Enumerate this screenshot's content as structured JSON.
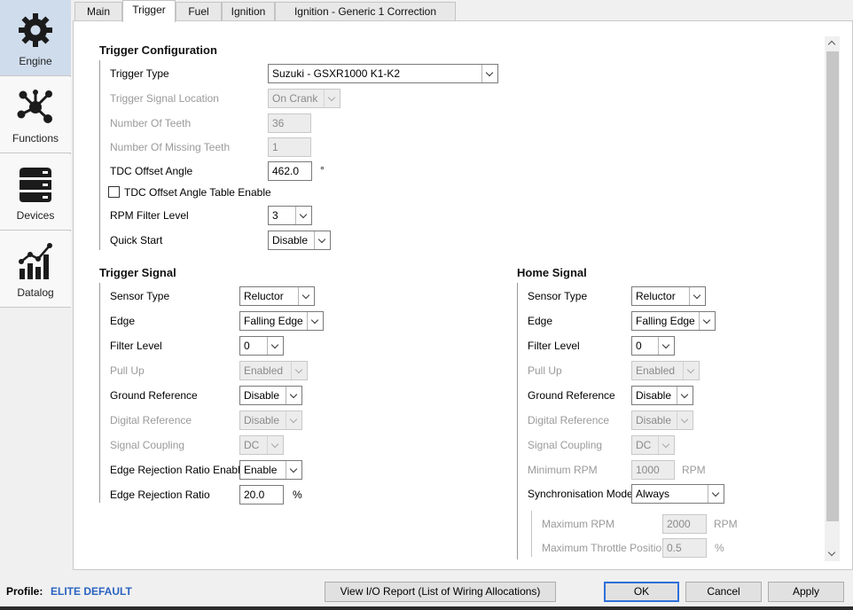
{
  "sidebar": {
    "items": [
      {
        "label": "Engine",
        "icon": "gear-icon",
        "active": true
      },
      {
        "label": "Functions",
        "icon": "network-icon",
        "active": false
      },
      {
        "label": "Devices",
        "icon": "server-icon",
        "active": false
      },
      {
        "label": "Datalog",
        "icon": "chart-icon",
        "active": false
      }
    ]
  },
  "tabs": [
    {
      "label": "Main"
    },
    {
      "label": "Trigger"
    },
    {
      "label": "Fuel"
    },
    {
      "label": "Ignition"
    },
    {
      "label": "Ignition - Generic 1 Correction"
    }
  ],
  "active_tab": "Trigger",
  "trigger_config": {
    "title": "Trigger Configuration",
    "trigger_type_label": "Trigger Type",
    "trigger_type_value": "Suzuki - GSXR1000 K1-K2",
    "signal_location_label": "Trigger Signal Location",
    "signal_location_value": "On Crank",
    "num_teeth_label": "Number Of Teeth",
    "num_teeth_value": "36",
    "missing_teeth_label": "Number Of Missing Teeth",
    "missing_teeth_value": "1",
    "tdc_offset_label": "TDC Offset Angle",
    "tdc_offset_value": "462.0",
    "tdc_offset_unit": "°",
    "tdc_table_label": "TDC Offset Angle Table Enable",
    "tdc_table_checked": false,
    "rpm_filter_label": "RPM Filter Level",
    "rpm_filter_value": "3",
    "quick_start_label": "Quick Start",
    "quick_start_value": "Disable"
  },
  "trigger_signal": {
    "title": "Trigger Signal",
    "sensor_type_label": "Sensor Type",
    "sensor_type_value": "Reluctor",
    "edge_label": "Edge",
    "edge_value": "Falling Edge",
    "filter_level_label": "Filter Level",
    "filter_level_value": "0",
    "pull_up_label": "Pull Up",
    "pull_up_value": "Enabled",
    "ground_ref_label": "Ground Reference",
    "ground_ref_value": "Disable",
    "digital_ref_label": "Digital Reference",
    "digital_ref_value": "Disable",
    "signal_coupling_label": "Signal Coupling",
    "signal_coupling_value": "DC",
    "edge_rej_enable_label": "Edge Rejection Ratio Enable",
    "edge_rej_enable_value": "Enable",
    "edge_rej_ratio_label": "Edge Rejection Ratio",
    "edge_rej_ratio_value": "20.0",
    "edge_rej_ratio_unit": "%"
  },
  "home_signal": {
    "title": "Home Signal",
    "sensor_type_label": "Sensor Type",
    "sensor_type_value": "Reluctor",
    "edge_label": "Edge",
    "edge_value": "Falling Edge",
    "filter_level_label": "Filter Level",
    "filter_level_value": "0",
    "pull_up_label": "Pull Up",
    "pull_up_value": "Enabled",
    "ground_ref_label": "Ground Reference",
    "ground_ref_value": "Disable",
    "digital_ref_label": "Digital Reference",
    "digital_ref_value": "Disable",
    "signal_coupling_label": "Signal Coupling",
    "signal_coupling_value": "DC",
    "min_rpm_label": "Minimum RPM",
    "min_rpm_value": "1000",
    "min_rpm_unit": "RPM",
    "sync_mode_label": "Synchronisation Mode",
    "sync_mode_value": "Always",
    "max_rpm_label": "Maximum RPM",
    "max_rpm_value": "2000",
    "max_rpm_unit": "RPM",
    "max_tp_label": "Maximum Throttle Position",
    "max_tp_value": "0.5",
    "max_tp_unit": "%"
  },
  "footer": {
    "profile_label": "Profile:",
    "profile_value": "ELITE DEFAULT",
    "io_report_label": "View I/O Report (List of Wiring Allocations)",
    "ok_label": "OK",
    "cancel_label": "Cancel",
    "apply_label": "Apply"
  },
  "colors": {
    "accent": "#2f6fd8",
    "profile_text": "#2a63c0",
    "sidebar_active": "#cfdcec"
  }
}
